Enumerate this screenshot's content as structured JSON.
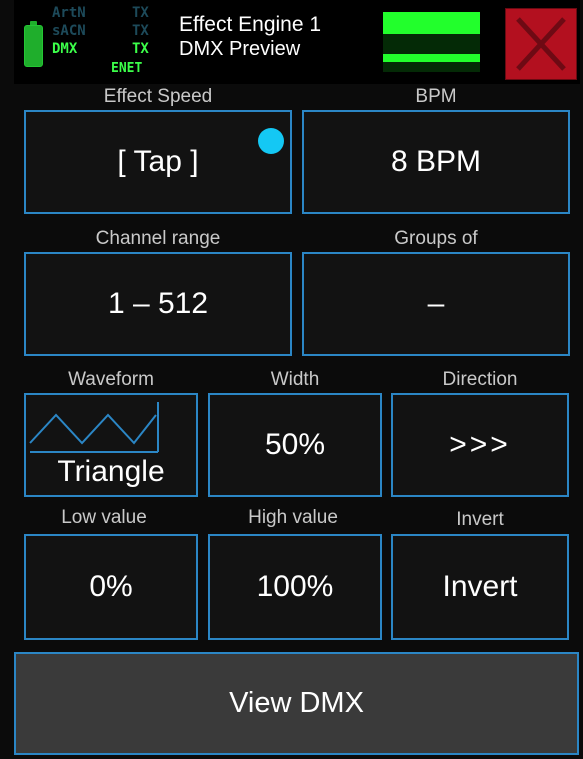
{
  "header": {
    "protocols": {
      "artnet": "ArtN",
      "sacn": "sACN",
      "dmx": "DMX"
    },
    "tx": [
      "TX",
      "TX",
      "TX"
    ],
    "enet": "ENET",
    "title": "Effect Engine 1",
    "subtitle": "DMX Preview",
    "colors": {
      "active": "#3cff4a",
      "inactive": "#1d4a5a",
      "close": "#b3101f"
    },
    "close_icon": "close-x-icon"
  },
  "speed": {
    "label": "Effect Speed",
    "value": "[ Tap ]",
    "indicator_color": "#14c8f4"
  },
  "bpm": {
    "label": "BPM",
    "value": "8 BPM"
  },
  "channel_range": {
    "label": "Channel range",
    "value": "1 – 512"
  },
  "groups": {
    "label": "Groups of",
    "value": "–"
  },
  "waveform": {
    "label": "Waveform",
    "value": "Triangle",
    "icon": "triangle-wave-icon"
  },
  "width": {
    "label": "Width",
    "value": "50%"
  },
  "direction": {
    "label": "Direction",
    "value": ">>>"
  },
  "low": {
    "label": "Low value",
    "value": "0%"
  },
  "high": {
    "label": "High value",
    "value": "100%"
  },
  "invert": {
    "label": "Invert",
    "value": "Invert"
  },
  "footer": {
    "button": "View DMX"
  },
  "theme": {
    "accent": "#2b86c5",
    "background": "#0b0b0b"
  }
}
